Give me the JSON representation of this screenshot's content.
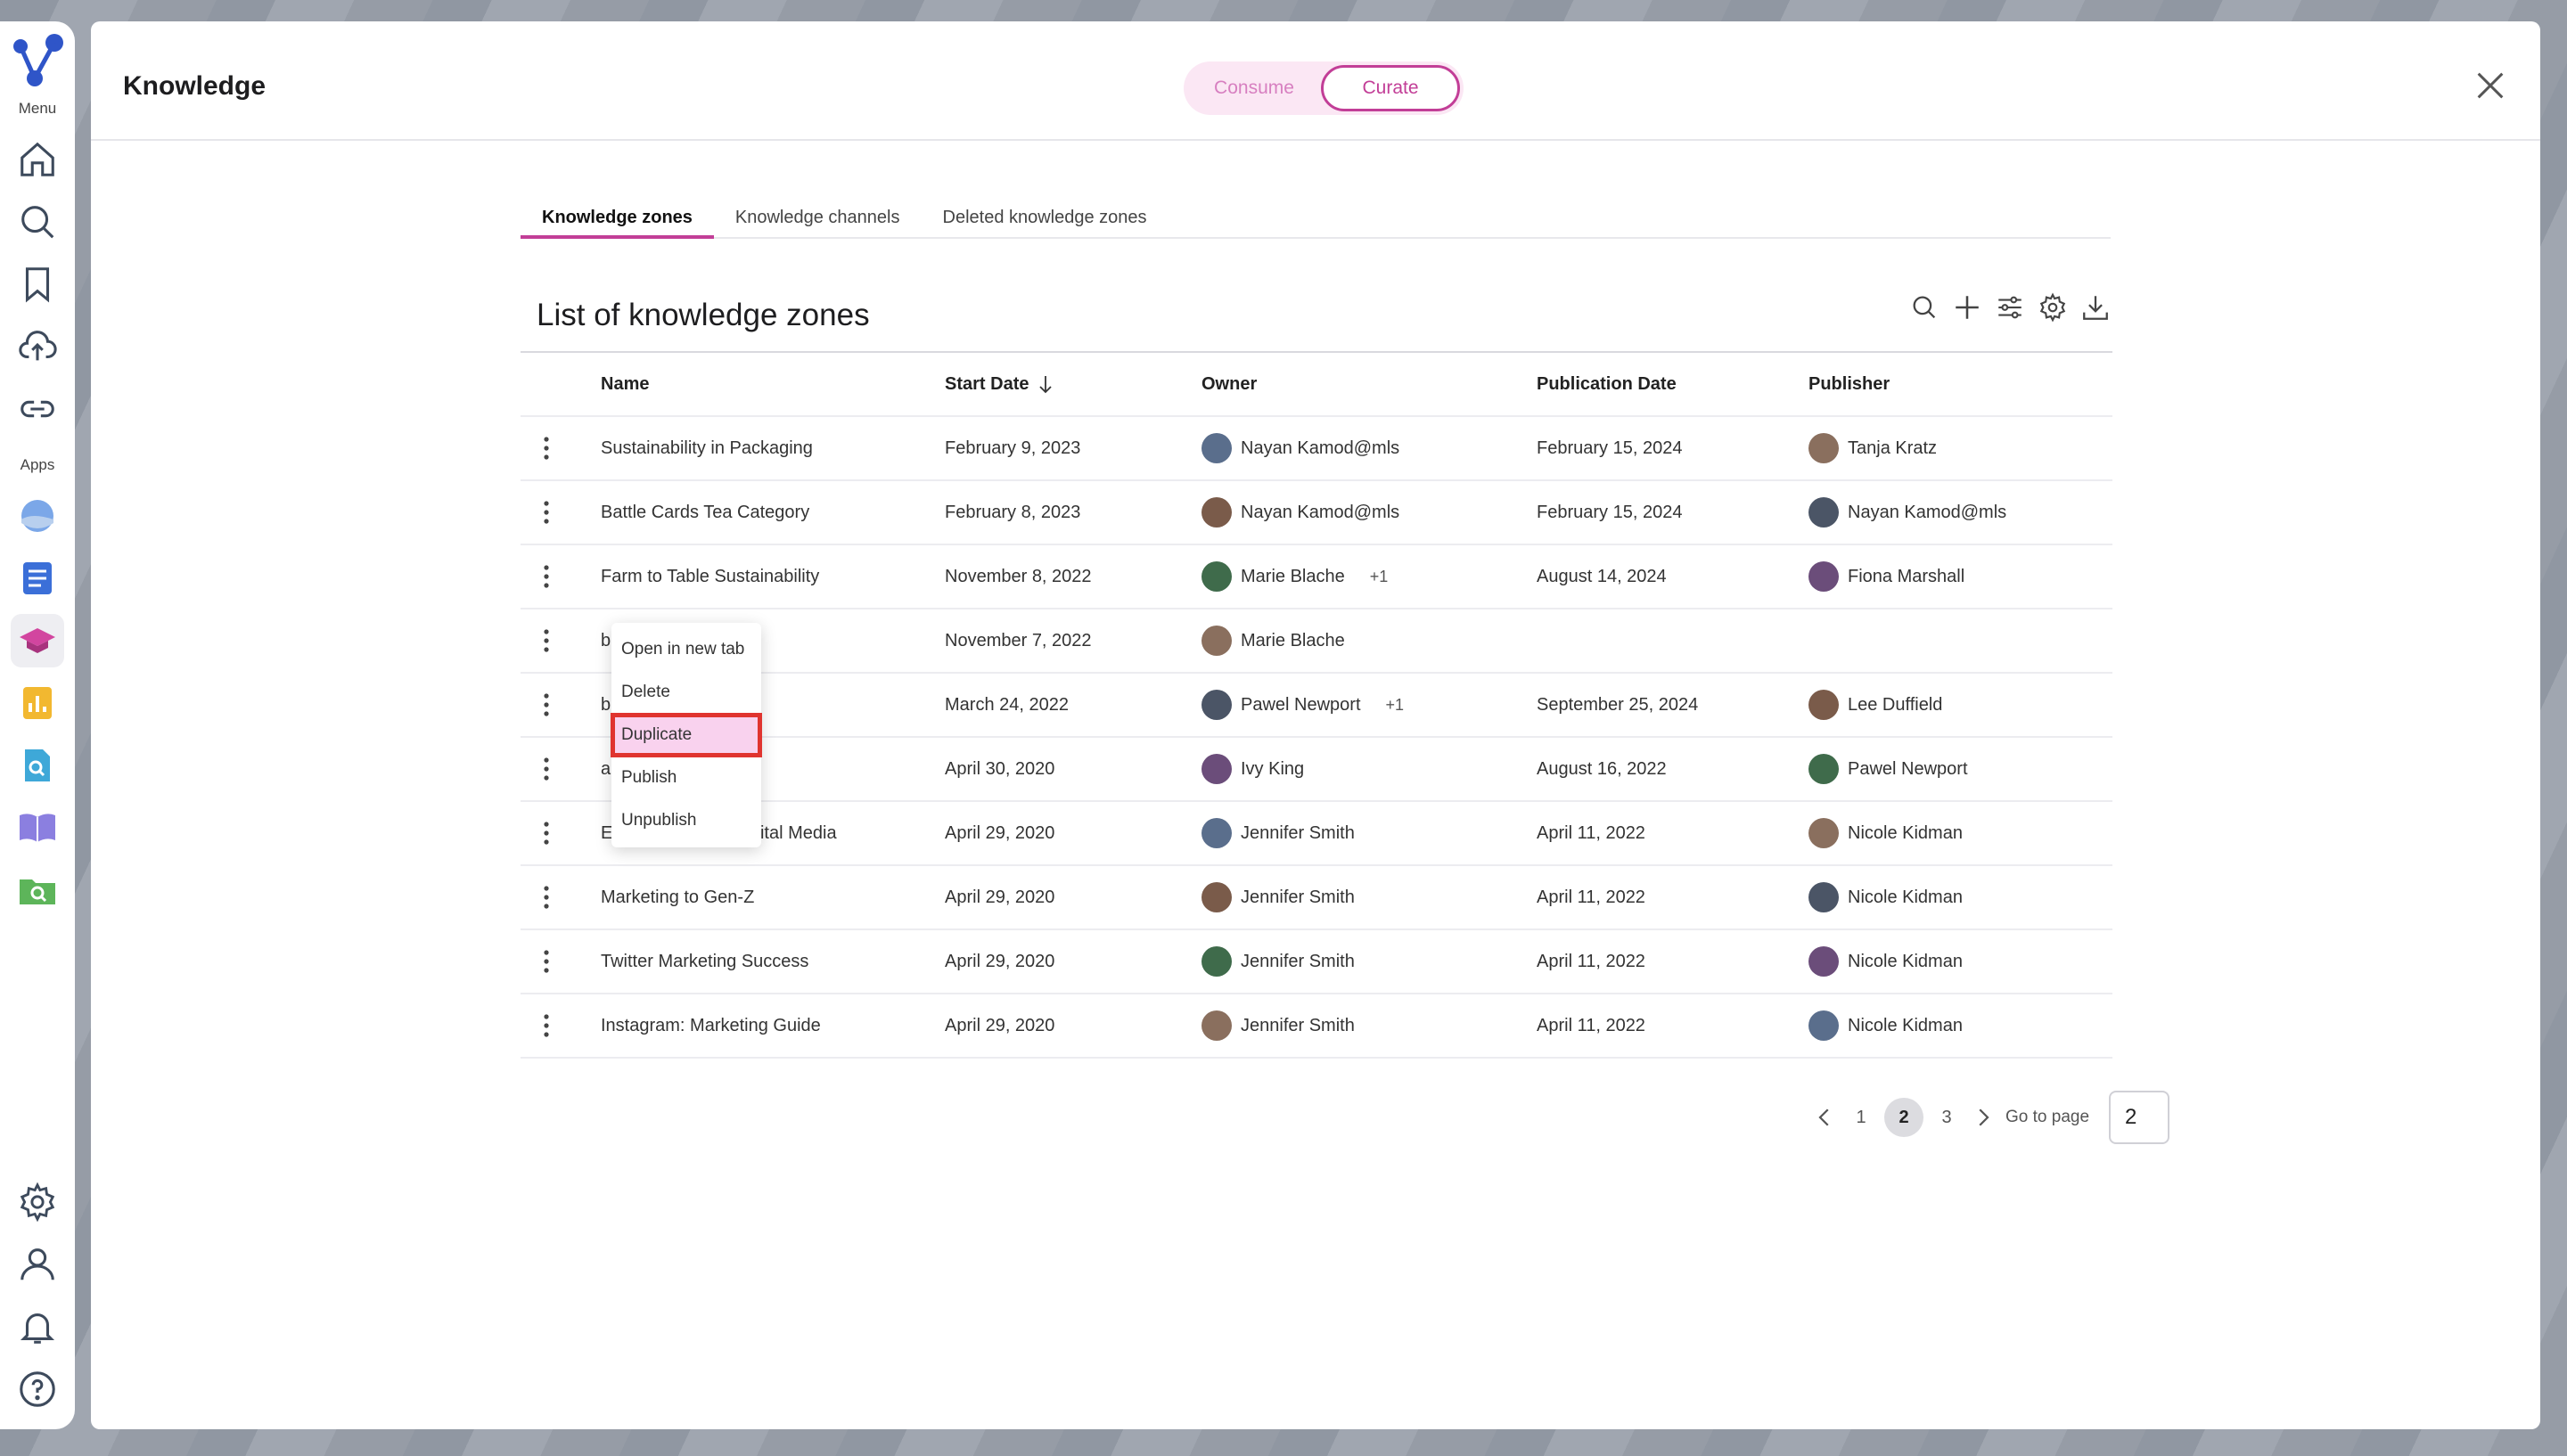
{
  "rail": {
    "menu_label": "Menu",
    "apps_label": "Apps"
  },
  "modal": {
    "title": "Knowledge",
    "mode_options": [
      "Consume",
      "Curate"
    ],
    "active_mode": "Curate"
  },
  "tabs": [
    "Knowledge zones",
    "Knowledge channels",
    "Deleted knowledge zones"
  ],
  "list_title": "List of knowledge zones",
  "columns": {
    "name": "Name",
    "start_date": "Start Date",
    "owner": "Owner",
    "publication_date": "Publication Date",
    "publisher": "Publisher"
  },
  "rows": [
    {
      "name": "Sustainability in Packaging",
      "start": "February 9, 2023",
      "owner": "Nayan Kamod@mls",
      "owner_extra": "",
      "pub": "February 15, 2024",
      "publisher": "Tanja Kratz"
    },
    {
      "name": "Battle Cards Tea Category",
      "start": "February 8, 2023",
      "owner": "Nayan Kamod@mls",
      "owner_extra": "",
      "pub": "February 15, 2024",
      "publisher": "Nayan Kamod@mls"
    },
    {
      "name": "Farm to Table Sustainability",
      "start": "November 8, 2022",
      "owner": "Marie Blache",
      "owner_extra": "+1",
      "pub": "August 14, 2024",
      "publisher": "Fiona Marshall"
    },
    {
      "name": "ble Agriculture",
      "start": "November 7, 2022",
      "owner": "Marie Blache",
      "owner_extra": "",
      "pub": "",
      "publisher": ""
    },
    {
      "name": "ble Food",
      "start": "March 24, 2022",
      "owner": "Pawel Newport",
      "owner_extra": "+1",
      "pub": "September 25, 2024",
      "publisher": "Lee Duffield"
    },
    {
      "name": "ards Tea Category",
      "start": "April 30, 2020",
      "owner": "Ivy King",
      "owner_extra": "",
      "pub": "August 16, 2022",
      "publisher": "Pawel Newport"
    },
    {
      "name": "Entertainment & Digital Media",
      "start": "April 29, 2020",
      "owner": "Jennifer Smith",
      "owner_extra": "",
      "pub": "April 11, 2022",
      "publisher": "Nicole Kidman"
    },
    {
      "name": "Marketing to Gen-Z",
      "start": "April 29, 2020",
      "owner": "Jennifer Smith",
      "owner_extra": "",
      "pub": "April 11, 2022",
      "publisher": "Nicole Kidman"
    },
    {
      "name": "Twitter Marketing Success",
      "start": "April 29, 2020",
      "owner": "Jennifer Smith",
      "owner_extra": "",
      "pub": "April 11, 2022",
      "publisher": "Nicole Kidman"
    },
    {
      "name": "Instagram: Marketing Guide",
      "start": "April 29, 2020",
      "owner": "Jennifer Smith",
      "owner_extra": "",
      "pub": "April 11, 2022",
      "publisher": "Nicole Kidman"
    }
  ],
  "context_menu": [
    "Open in new tab",
    "Delete",
    "Duplicate",
    "Publish",
    "Unpublish"
  ],
  "context_menu_highlight": "Duplicate",
  "pagination": {
    "pages": [
      "1",
      "2",
      "3"
    ],
    "current": "2",
    "goto_label": "Go to page",
    "goto_value": "2"
  },
  "colors": {
    "accent": "#c23e97",
    "accent_light": "#fbe7f4",
    "highlight_outline": "#e0342f",
    "highlight_fill": "#f9d2ee"
  }
}
